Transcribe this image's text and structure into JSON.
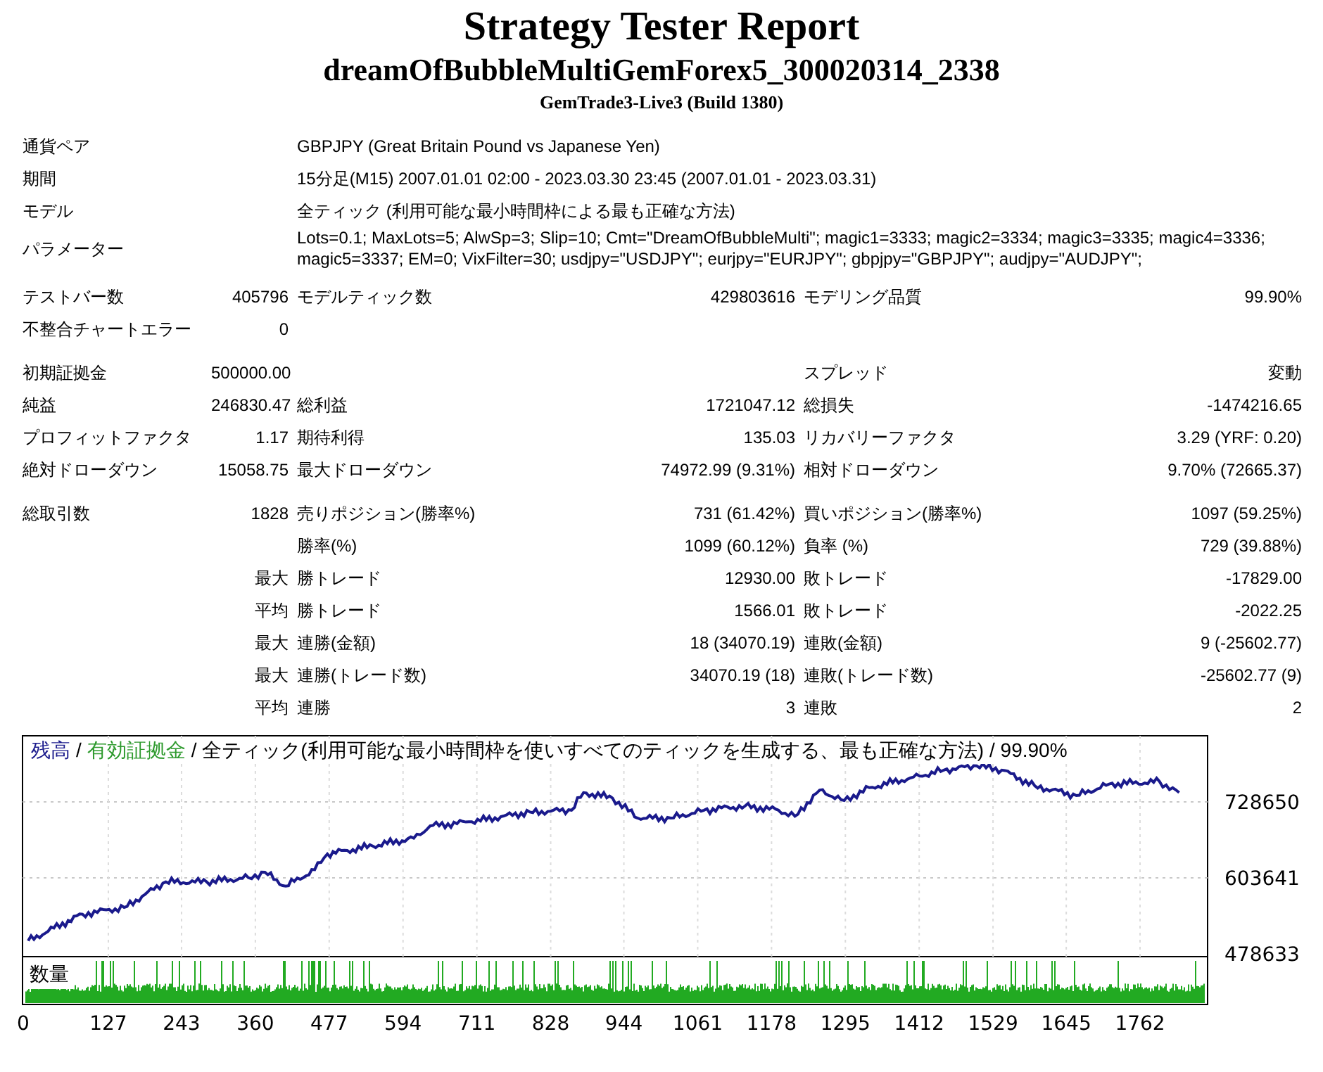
{
  "header": {
    "title": "Strategy Tester Report",
    "subtitle": "dreamOfBubbleMultiGemForex5_300020314_2338",
    "build": "GemTrade3-Live3 (Build 1380)"
  },
  "settings": [
    {
      "label": "通貨ペア",
      "value": "GBPJPY (Great Britain Pound vs Japanese Yen)"
    },
    {
      "label": "期間",
      "value": "15分足(M15) 2007.01.01 02:00 - 2023.03.30 23:45 (2007.01.01 - 2023.03.31)"
    },
    {
      "label": "モデル",
      "value": "全ティック (利用可能な最小時間枠による最も正確な方法)"
    },
    {
      "label": "パラメーター",
      "value": "Lots=0.1; MaxLots=5; AlwSp=3; Slip=10; Cmt=\"DreamOfBubbleMulti\"; magic1=3333; magic2=3334; magic3=3335; magic4=3336; magic5=3337; EM=0; VixFilter=30; usdjpy=\"USDJPY\"; eurjpy=\"EURJPY\"; gbpjpy=\"GBPJPY\"; audjpy=\"AUDJPY\";"
    }
  ],
  "stat_groups": [
    [
      {
        "label_a": "テストバー数",
        "value_a": "405796",
        "label_b": "モデルティック数",
        "value_b": "429803616",
        "label_c": "モデリング品質",
        "value_c": "99.90%"
      },
      {
        "label_a": "不整合チャートエラー",
        "value_a": "0"
      }
    ],
    [
      {
        "label_a": "初期証拠金",
        "value_a": "500000.00",
        "label_c": "スプレッド",
        "value_c": "変動"
      },
      {
        "label_a": "純益",
        "value_a": "246830.47",
        "label_b": "総利益",
        "value_b": "1721047.12",
        "label_c": "総損失",
        "value_c": "-1474216.65"
      },
      {
        "label_a": "プロフィットファクタ",
        "value_a": "1.17",
        "label_b": "期待利得",
        "value_b": "135.03",
        "label_c": "リカバリーファクタ",
        "value_c": "3.29 (YRF: 0.20)"
      },
      {
        "label_a": "絶対ドローダウン",
        "value_a": "15058.75",
        "label_b": "最大ドローダウン",
        "value_b": "74972.99 (9.31%)",
        "label_c": "相対ドローダウン",
        "value_c": "9.70% (72665.37)"
      }
    ],
    [
      {
        "label_a": "総取引数",
        "value_a": "1828",
        "label_b": "売りポジション(勝率%)",
        "value_b": "731 (61.42%)",
        "label_c": "買いポジション(勝率%)",
        "value_c": "1097 (59.25%)"
      },
      {
        "label_b": "勝率(%)",
        "value_b": "1099 (60.12%)",
        "label_c": "負率 (%)",
        "value_c": "729 (39.88%)"
      },
      {
        "value_a": "最大",
        "label_b": "勝トレード",
        "value_b": "12930.00",
        "label_c": "敗トレード",
        "value_c": "-17829.00"
      },
      {
        "value_a": "平均",
        "label_b": "勝トレード",
        "value_b": "1566.01",
        "label_c": "敗トレード",
        "value_c": "-2022.25"
      },
      {
        "value_a": "最大",
        "label_b": "連勝(金額)",
        "value_b": "18 (34070.19)",
        "label_c": "連敗(金額)",
        "value_c": "9 (-25602.77)"
      },
      {
        "value_a": "最大",
        "label_b": "連勝(トレード数)",
        "value_b": "34070.19 (18)",
        "label_c": "連敗(トレード数)",
        "value_c": "-25602.77 (9)"
      },
      {
        "value_a": "平均",
        "label_b": "連勝",
        "value_b": "3",
        "label_c": "連敗",
        "value_c": "2"
      }
    ]
  ],
  "chart": {
    "legend": [
      {
        "text": "/",
        "color": "#000000"
      },
      {
        "text": "有効証拠金",
        "color": "#2e9a2e"
      },
      {
        "text": "/ 全ティック(利用可能な最小時間枠を使いすべてのティックを生成する、最も正確な方法)",
        "color": "#000000"
      },
      {
        "text": "/ 99.90%",
        "color": "#000000"
      }
    ],
    "volume_label": "数量",
    "chart_data": {
      "type": "line",
      "ylim": [
        474000,
        837500
      ],
      "xlim": [
        -9,
        1869
      ],
      "grid": true,
      "yticks": [
        478633,
        603641,
        728650
      ],
      "xticks": [
        0,
        127,
        243,
        360,
        477,
        594,
        711,
        828,
        944,
        1061,
        1178,
        1295,
        1412,
        1529,
        1645,
        1762
      ],
      "x": [
        0,
        86,
        152,
        218,
        283,
        349,
        375,
        408,
        454,
        474,
        546,
        611,
        637,
        703,
        795,
        861,
        880,
        926,
        966,
        1018,
        1071,
        1136,
        1189,
        1215,
        1254,
        1293,
        1333,
        1398,
        1451,
        1503,
        1543,
        1595,
        1661,
        1713,
        1793,
        1824
      ],
      "series": [
        {
          "name": "残高",
          "color": "#1a1a8c",
          "values": [
            500000,
            544000,
            555000,
            597000,
            597000,
            604000,
            613000,
            590000,
            617000,
            643000,
            656000,
            669000,
            689000,
            696000,
            712000,
            715000,
            744000,
            735000,
            702000,
            702000,
            715000,
            722000,
            715000,
            705000,
            748000,
            731000,
            752000,
            768000,
            781000,
            788000,
            781000,
            755000,
            739000,
            758000,
            762000,
            744000
          ]
        }
      ]
    }
  }
}
